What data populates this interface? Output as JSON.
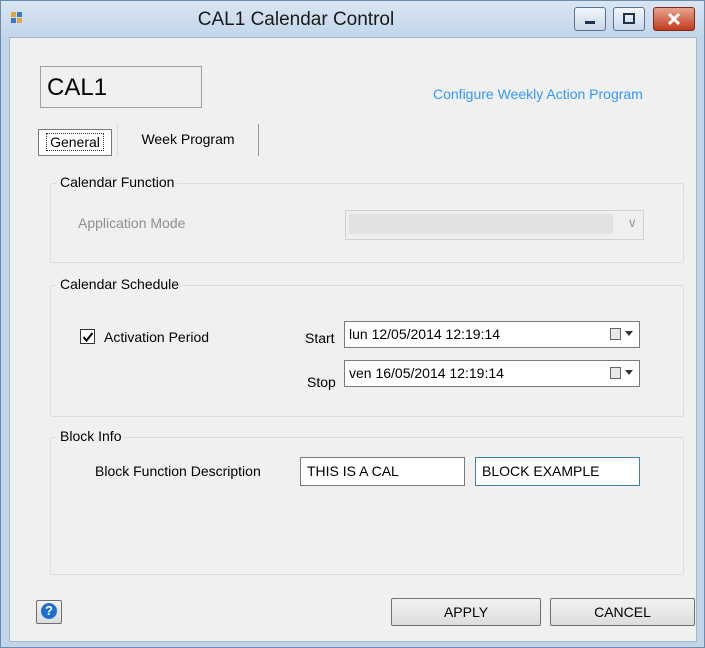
{
  "window": {
    "title": "CAL1 Calendar Control"
  },
  "block_name": "CAL1",
  "link": "Configure Weekly Action Program",
  "tabs": [
    {
      "label": "General"
    },
    {
      "label": "Week Program"
    }
  ],
  "calendar_function": {
    "group_label": "Calendar Function",
    "application_mode_label": "Application Mode",
    "application_mode_value": ""
  },
  "calendar_schedule": {
    "group_label": "Calendar Schedule",
    "activation_label": "Activation Period",
    "activation_checked": true,
    "start_label": "Start",
    "start_value": "lun  12/05/2014 12:19:14",
    "stop_label": "Stop",
    "stop_value": "ven 16/05/2014 12:19:14"
  },
  "block_info": {
    "group_label": "Block Info",
    "description_label": "Block Function Description",
    "description_part1": "THIS IS A CAL",
    "description_part2": "BLOCK EXAMPLE"
  },
  "buttons": {
    "apply": "APPLY",
    "cancel": "CANCEL",
    "help": "?"
  },
  "colors": {
    "link": "#3399ff",
    "help_icon": "#1f6fd0",
    "close_button": "#c23a1f"
  }
}
